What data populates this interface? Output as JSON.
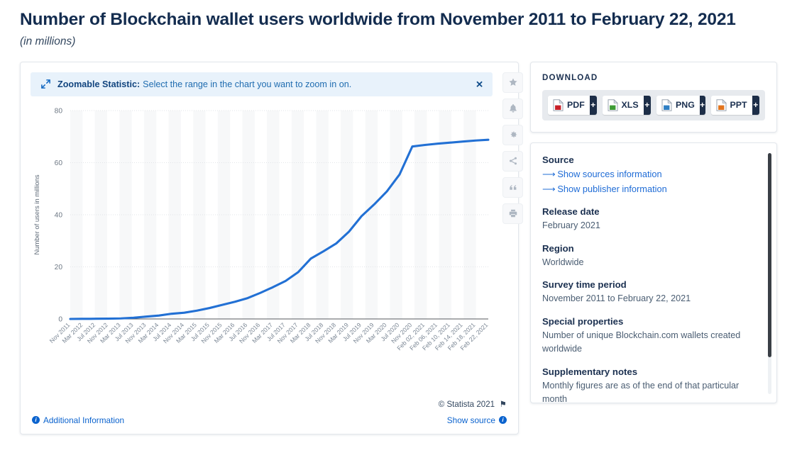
{
  "header": {
    "title": "Number of Blockchain wallet users worldwide from November 2011 to February 22, 2021",
    "subtitle": "(in millions)"
  },
  "banner": {
    "strong": "Zoomable Statistic:",
    "text": "Select the range in the chart you want to zoom in on.",
    "close": "✕"
  },
  "toolbar": {
    "items": [
      {
        "name": "favorite-star-icon"
      },
      {
        "name": "notification-bell-icon"
      },
      {
        "name": "settings-gear-icon"
      },
      {
        "name": "share-icon"
      },
      {
        "name": "citation-quote-icon"
      },
      {
        "name": "print-icon"
      }
    ]
  },
  "chart_footer": {
    "copyright": "© Statista 2021",
    "additional_information": "Additional Information",
    "show_source": "Show source"
  },
  "download": {
    "title": "DOWNLOAD",
    "buttons": [
      {
        "label": "PDF",
        "plus": "+",
        "color": "#c81f27"
      },
      {
        "label": "XLS",
        "plus": "+",
        "color": "#3e9c35"
      },
      {
        "label": "PNG",
        "plus": "+",
        "color": "#2f7fc4"
      },
      {
        "label": "PPT",
        "plus": "+",
        "color": "#e2741d"
      }
    ]
  },
  "source_panel": {
    "source_head": "Source",
    "link_sources": "Show sources information",
    "link_publisher": "Show publisher information",
    "release_date_head": "Release date",
    "release_date": "February 2021",
    "region_head": "Region",
    "region": "Worldwide",
    "survey_head": "Survey time period",
    "survey": "November 2011 to February 22, 2021",
    "special_head": "Special properties",
    "special": "Number of unique Blockchain.com wallets created worldwide",
    "notes_head": "Supplementary notes",
    "notes": "Monthly figures are as of the end of that particular month"
  },
  "chart_data": {
    "type": "line",
    "title": "Number of Blockchain wallet users worldwide from November 2011 to February 22, 2021",
    "subtitle": "(in millions)",
    "xlabel": "",
    "ylabel": "Number of users in millions",
    "ylim": [
      0,
      80
    ],
    "yticks": [
      0,
      20,
      40,
      60,
      80
    ],
    "grid": true,
    "legend": false,
    "line_color": "#2270d4",
    "categories": [
      "Nov 2011",
      "Mar 2012",
      "Jul 2012",
      "Nov 2012",
      "Mar 2013",
      "Jul 2013",
      "Nov 2013",
      "Mar 2014",
      "Jul 2014",
      "Nov 2014",
      "Mar 2015",
      "Jul 2015",
      "Nov 2015",
      "Mar 2016",
      "Jul 2016",
      "Nov 2016",
      "Mar 2017",
      "Jul 2017",
      "Nov 2017",
      "Mar 2018",
      "Jul 2018",
      "Nov 2018",
      "Mar 2019",
      "Jul 2019",
      "Nov 2019",
      "Mar 2020",
      "Jul 2020",
      "Nov 2020",
      "Feb 02, 2021",
      "Feb 06, 2021",
      "Feb 10, 2021",
      "Feb 14, 2021",
      "Feb 18, 2021",
      "Feb 22, 2021"
    ],
    "values": [
      0.0,
      0.04,
      0.08,
      0.13,
      0.2,
      0.45,
      0.9,
      1.3,
      2.0,
      2.4,
      3.2,
      4.2,
      5.4,
      6.6,
      8.0,
      10.0,
      12.2,
      14.6,
      18.0,
      23.2,
      26.0,
      29.0,
      33.5,
      39.5,
      44.0,
      49.0,
      55.5,
      66.2,
      66.8,
      67.3,
      67.7,
      68.1,
      68.5,
      68.8
    ]
  }
}
